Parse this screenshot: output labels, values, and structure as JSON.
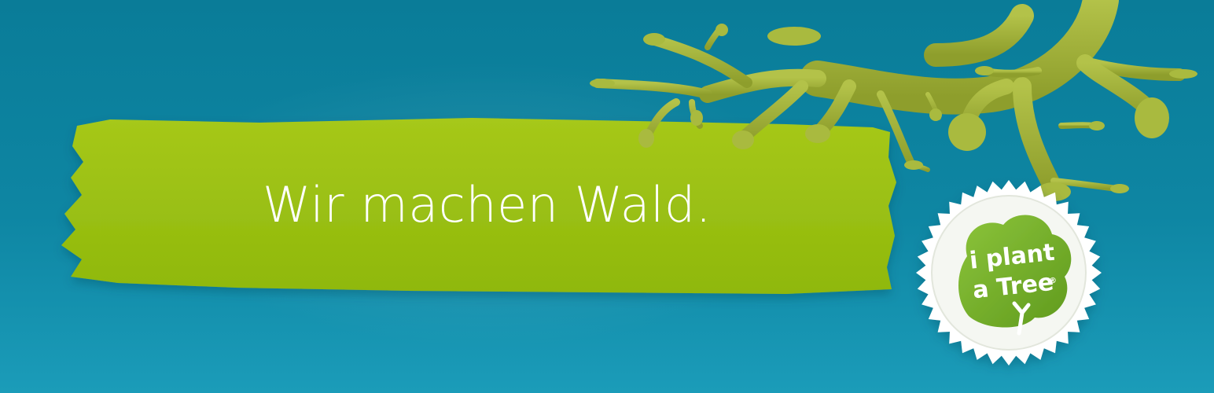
{
  "banner": {
    "tagline": "Wir machen Wald.",
    "colors": {
      "background_top": "#0a7c98",
      "background_bottom": "#1b9cb9",
      "brush_stroke": "#99c00f",
      "hands": "#a8b83c",
      "badge": "#ffffff",
      "logo_green": "#7cb32a"
    }
  },
  "logo": {
    "line1": "i plant",
    "line2": "a Tree",
    "mark": "®"
  }
}
